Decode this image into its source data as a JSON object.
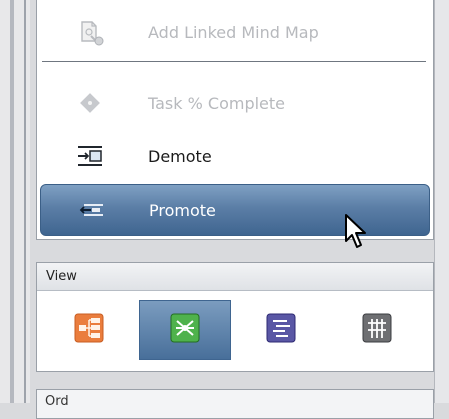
{
  "menu": {
    "items": [
      {
        "label": "Add Linked Mind Map",
        "state": "disabled",
        "icon": "linked-map-icon"
      },
      {
        "label": "Task % Complete",
        "state": "disabled",
        "icon": "diamond-icon"
      },
      {
        "label": "Demote",
        "state": "enabled",
        "icon": "demote-icon"
      },
      {
        "label": "Promote",
        "state": "selected",
        "icon": "promote-icon"
      }
    ]
  },
  "view": {
    "header": "View",
    "buttons": [
      {
        "name": "mind-map-view",
        "icon": "orange-branch-icon",
        "active": false
      },
      {
        "name": "map-view",
        "icon": "green-network-icon",
        "active": true
      },
      {
        "name": "outline-view",
        "icon": "blue-outline-icon",
        "active": false
      },
      {
        "name": "gantt-view",
        "icon": "gray-grid-icon",
        "active": false
      }
    ]
  },
  "next_panel": {
    "label": "Ord"
  },
  "colors": {
    "selected_top": "#7fa0c3",
    "selected_bottom": "#3f6590",
    "disabled_text": "#b7b9bd"
  }
}
